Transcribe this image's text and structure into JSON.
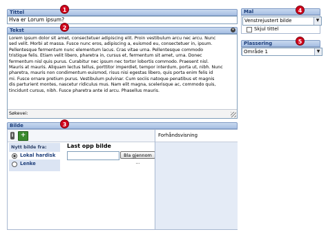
{
  "markers": [
    "1",
    "2",
    "3",
    "4",
    "5"
  ],
  "title_section": {
    "label": "Tittel",
    "value": "Hva er Lorum ipsum?"
  },
  "text_section": {
    "label": "Tekst",
    "collapse_icon": "collapse-circle-icon",
    "lines": [
      "Lorem ipsum dolor sit amet, consectetuer adipiscing elit. Proin vestibulum arcu nec arcu. Nunc",
      "sed velit. Morbi at massa. Fusce nunc eros, adipiscing a, euismod eu, consectetuer in, ipsum.",
      "Pellentesque fermentum nunc elementum lacus. Cras vitae urna. Pellentesque commodo",
      "tristique felis. Etiam velit libero, pharetra in, cursus et, fermentum sit amet, urna. Donec",
      "fermentum nisl quis purus. Curabitur nec ipsum nec tortor lobortis commodo. Praesent nisl.",
      "Mauris at mauris. Aliquam lectus tellus, porttitor imperdiet, tempor interdum, porta ut, nibh. Nunc",
      "pharetra, mauris non condimentum euismod, risus nisi egestas libero, quis porta enim felis id",
      "mi. Fusce ornare pretium purus. Vestibulum pulvinar. Cum sociis natoque penatibus et magnis",
      "dis parturient montes, nascetur ridiculus mus. Nam elit magna, scelerisque ac, commodo quis,",
      "tincidunt cursus, nibh. Fusce pharetra ante id arcu. Phasellus mauris."
    ],
    "footer_label": "Søkevei:"
  },
  "image_section": {
    "label": "Bilde",
    "toolbar_icons": [
      "info-icon",
      "add-image-icon"
    ],
    "new_image_from": "Nytt bilde fra:",
    "options": [
      {
        "label": "Lokal hardisk",
        "selected": true
      },
      {
        "label": "Lenke",
        "selected": false
      }
    ],
    "upload_title": "Last opp bilde",
    "file_value": "",
    "browse_label": "Bla gjennom ...",
    "preview_label": "Forhåndsvisning"
  },
  "mal_section": {
    "label": "Mal",
    "selected": "Venstrejustert bilde",
    "hide_title_label": "Skjul tittel",
    "hide_title_checked": false
  },
  "placement_section": {
    "label": "Plassering",
    "selected": "Område 1"
  },
  "colors": {
    "header_text": "#1c3d7a",
    "marker": "#d0021b",
    "preview_bg": "#e4ebf6",
    "options_bg": "#dbe4f3"
  }
}
